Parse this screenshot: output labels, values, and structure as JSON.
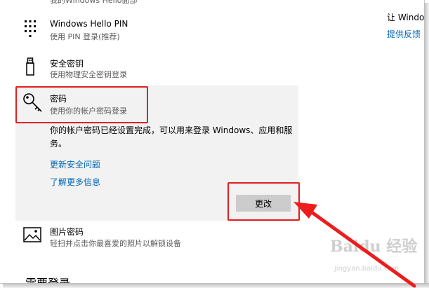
{
  "top_item": {
    "subtitle": "我的Windows Hello面部"
  },
  "items": [
    {
      "title": "Windows Hello PIN",
      "subtitle": "使用 PIN 登录(推荐)",
      "icon": "pin-keypad-icon"
    },
    {
      "title": "安全密钥",
      "subtitle": "使用物理安全密钥登录",
      "icon": "usb-key-icon"
    },
    {
      "title": "密码",
      "subtitle": "使用你的帐户密码登录",
      "icon": "key-icon"
    },
    {
      "title": "图片密码",
      "subtitle": "轻扫并点击你最喜爱的照片以解锁设备",
      "icon": "picture-icon"
    }
  ],
  "password_panel": {
    "description": "你的帐户密码已经设置完成，可以用来登录 Windows、应用和服务。",
    "link_security_questions": "更新安全问题",
    "link_learn_more": "了解更多信息",
    "change_button": "更改"
  },
  "right_panel": {
    "text": "让 Windo",
    "link": "提供反馈"
  },
  "bottom_heading": "需要登录",
  "watermark": {
    "logo": "Baidu 经验",
    "sub": "jingyan.baidu.com"
  },
  "colors": {
    "accent_link": "#0067b8",
    "highlight": "#e02020",
    "panel": "#f2f2f2"
  }
}
